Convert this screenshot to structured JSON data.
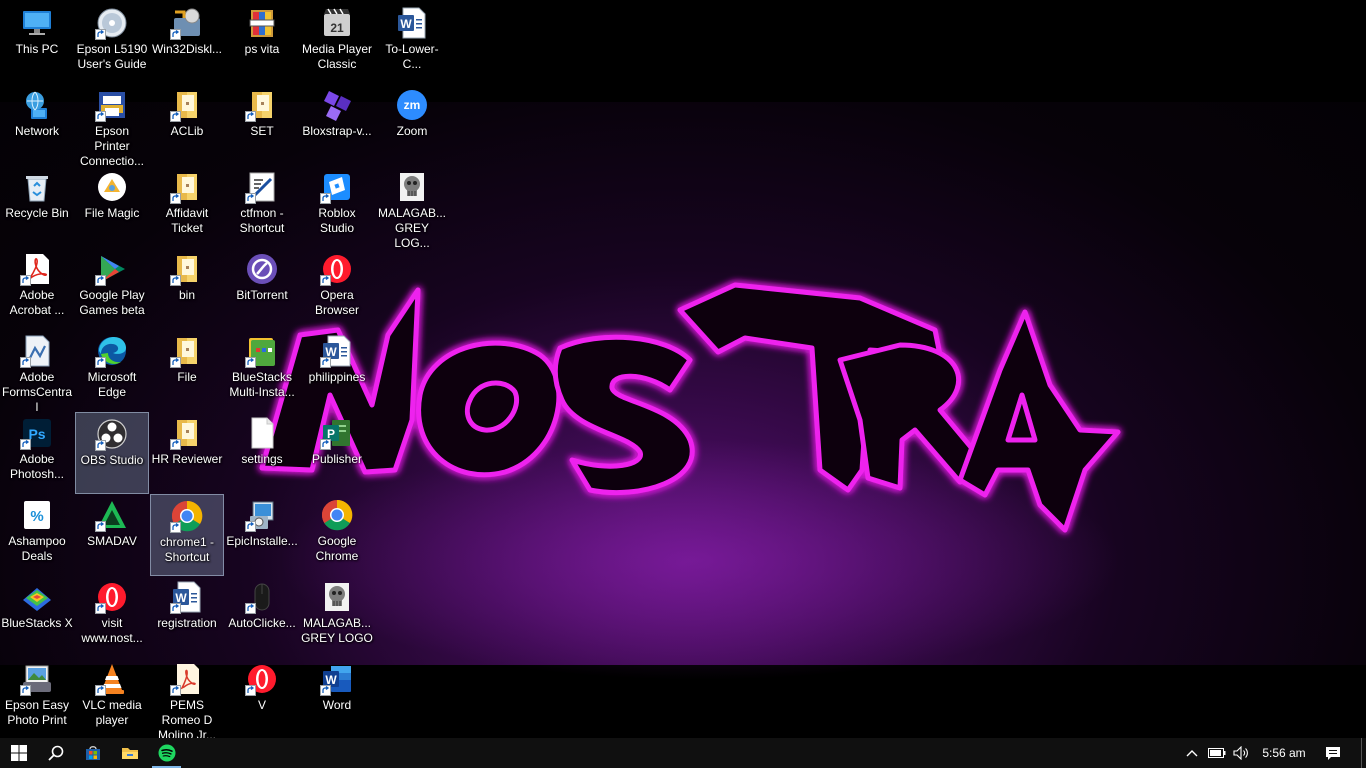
{
  "wallpaper": {
    "text": "NOSTRA",
    "accent_color": "#e020e0"
  },
  "desktop": {
    "icons": [
      {
        "label": "This PC",
        "icon": "pc-icon",
        "shortcut": false
      },
      {
        "label": "Network",
        "icon": "network-icon",
        "shortcut": false
      },
      {
        "label": "Recycle Bin",
        "icon": "recycle-bin-icon",
        "shortcut": false
      },
      {
        "label": "Adobe Acrobat ...",
        "icon": "acrobat-icon",
        "shortcut": true
      },
      {
        "label": "Adobe FormsCentral",
        "icon": "forms-icon",
        "shortcut": true
      },
      {
        "label": "Adobe Photosh...",
        "icon": "photoshop-icon",
        "shortcut": true
      },
      {
        "label": "Ashampoo Deals",
        "icon": "ashampoo-icon",
        "shortcut": false
      },
      {
        "label": "BlueStacks X",
        "icon": "bluestacks-x-icon",
        "shortcut": false
      },
      {
        "label": "Epson Easy Photo Print",
        "icon": "epson-photo-icon",
        "shortcut": true
      },
      {
        "label": "Epson L5190 User's Guide",
        "icon": "guide-icon",
        "shortcut": true
      },
      {
        "label": "Epson Printer Connectio...",
        "icon": "printer-icon",
        "shortcut": true
      },
      {
        "label": "File Magic",
        "icon": "file-magic-icon",
        "shortcut": false
      },
      {
        "label": "Google Play Games beta",
        "icon": "play-games-icon",
        "shortcut": true
      },
      {
        "label": "Microsoft Edge",
        "icon": "edge-icon",
        "shortcut": true
      },
      {
        "label": "OBS Studio",
        "icon": "obs-icon",
        "shortcut": true
      },
      {
        "label": "SMADAV",
        "icon": "smadav-icon",
        "shortcut": true
      },
      {
        "label": "visit www.nost...",
        "icon": "opera-icon",
        "shortcut": true
      },
      {
        "label": "VLC media player",
        "icon": "vlc-icon",
        "shortcut": true
      },
      {
        "label": "Win32Diskl...",
        "icon": "disk-imager-icon",
        "shortcut": true
      },
      {
        "label": "ACLib",
        "icon": "folder-icon",
        "shortcut": true
      },
      {
        "label": "Affidavit Ticket",
        "icon": "folder-icon",
        "shortcut": true
      },
      {
        "label": "bin",
        "icon": "folder-icon",
        "shortcut": true
      },
      {
        "label": "File",
        "icon": "folder-icon",
        "shortcut": true
      },
      {
        "label": "HR Reviewer",
        "icon": "folder-icon",
        "shortcut": true
      },
      {
        "label": "chrome1 - Shortcut",
        "icon": "chrome-icon",
        "shortcut": true
      },
      {
        "label": "registration",
        "icon": "word-doc-icon",
        "shortcut": true
      },
      {
        "label": "PEMS Romeo D Molino Jr...",
        "icon": "pdf-icon",
        "shortcut": true
      },
      {
        "label": "ps vita",
        "icon": "archive-icon",
        "shortcut": false
      },
      {
        "label": "SET",
        "icon": "folder-icon",
        "shortcut": true
      },
      {
        "label": "ctfmon - Shortcut",
        "icon": "ctfmon-icon",
        "shortcut": true
      },
      {
        "label": "BitTorrent",
        "icon": "bittorrent-icon",
        "shortcut": false
      },
      {
        "label": "BlueStacks Multi-Insta...",
        "icon": "bluestacks-icon",
        "shortcut": true
      },
      {
        "label": "settings",
        "icon": "file-icon",
        "shortcut": false
      },
      {
        "label": "EpicInstalle...",
        "icon": "installer-icon",
        "shortcut": true
      },
      {
        "label": "AutoClicke...",
        "icon": "mouse-icon",
        "shortcut": true
      },
      {
        "label": "V",
        "icon": "opera-icon",
        "shortcut": true
      },
      {
        "label": "Media Player Classic",
        "icon": "media-player-icon",
        "shortcut": false
      },
      {
        "label": "Bloxstrap-v...",
        "icon": "bloxstrap-icon",
        "shortcut": false
      },
      {
        "label": "Roblox Studio",
        "icon": "roblox-studio-icon",
        "shortcut": true
      },
      {
        "label": "Opera Browser",
        "icon": "opera-icon",
        "shortcut": true
      },
      {
        "label": "philippines",
        "icon": "word-doc-icon",
        "shortcut": true
      },
      {
        "label": "Publisher",
        "icon": "publisher-icon",
        "shortcut": true
      },
      {
        "label": "Google Chrome",
        "icon": "chrome-icon",
        "shortcut": false
      },
      {
        "label": "MALAGAB... GREY LOGO",
        "icon": "skull-icon",
        "shortcut": false
      },
      {
        "label": "Word",
        "icon": "word-icon",
        "shortcut": true
      },
      {
        "label": "To-Lower-C...",
        "icon": "word-doc-icon",
        "shortcut": false
      },
      {
        "label": "Zoom",
        "icon": "zoom-icon",
        "shortcut": false
      },
      {
        "label": "MALAGAB... GREY LOG...",
        "icon": "skull-icon",
        "shortcut": false
      }
    ]
  },
  "taskbar": {
    "apps": [
      {
        "name": "start-button-icon",
        "label": "Start"
      },
      {
        "name": "search-icon",
        "label": "Search"
      },
      {
        "name": "store-icon",
        "label": "Microsoft Store"
      },
      {
        "name": "file-explorer-icon",
        "label": "File Explorer"
      },
      {
        "name": "spotify-icon",
        "label": "Spotify",
        "active": true
      }
    ],
    "tray": {
      "clock": "5:56 am"
    }
  }
}
